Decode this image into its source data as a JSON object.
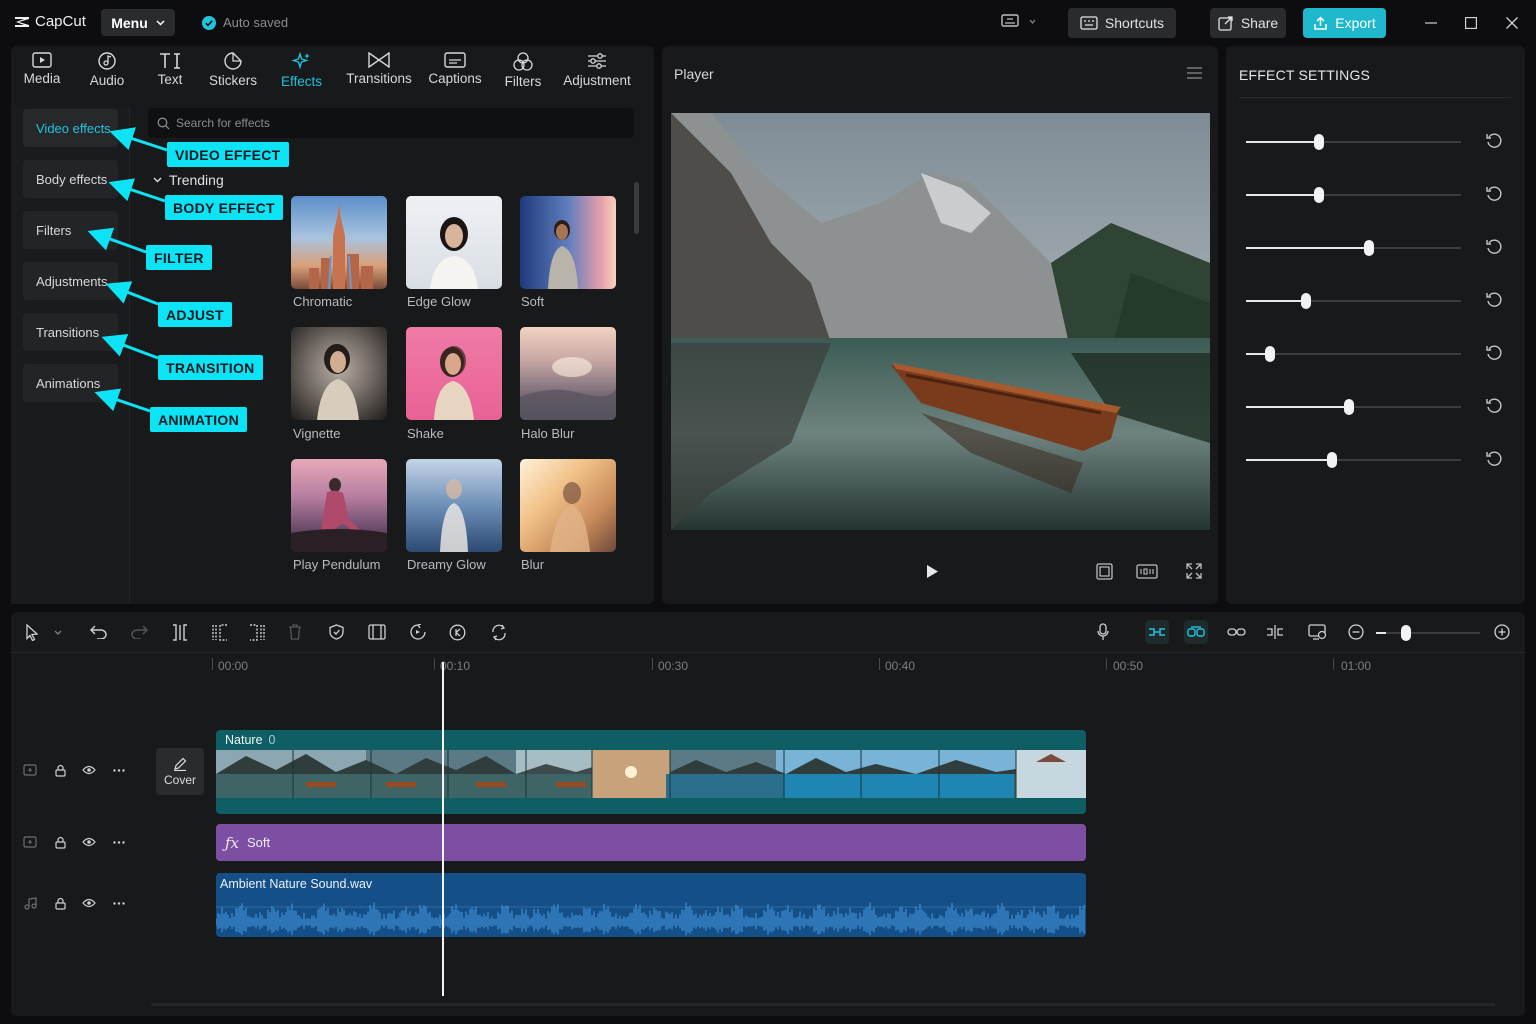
{
  "app": {
    "name": "CapCut",
    "menu_label": "Menu",
    "autosave_text": "Auto saved"
  },
  "topbar": {
    "shortcuts_label": "Shortcuts",
    "share_label": "Share",
    "export_label": "Export"
  },
  "colors": {
    "accent": "#21c3dd",
    "callout": "#0ce3f4",
    "export": "#1fb7cc",
    "effect_clip": "#7c4fa3",
    "audio_clip": "#154f88",
    "video_clip": "#0f5e63"
  },
  "tabs": [
    {
      "label": "Media",
      "icon": "media-icon"
    },
    {
      "label": "Audio",
      "icon": "audio-icon"
    },
    {
      "label": "Text",
      "icon": "text-icon"
    },
    {
      "label": "Stickers",
      "icon": "stickers-icon"
    },
    {
      "label": "Effects",
      "icon": "effects-icon",
      "active": true
    },
    {
      "label": "Transitions",
      "icon": "transitions-icon"
    },
    {
      "label": "Captions",
      "icon": "captions-icon"
    },
    {
      "label": "Filters",
      "icon": "filters-icon"
    },
    {
      "label": "Adjustment",
      "icon": "adjustment-icon"
    }
  ],
  "categories": [
    "Video effects",
    "Body effects",
    "Filters",
    "Adjustments",
    "Transitions",
    "Animations"
  ],
  "callouts": [
    "VIDEO EFFECT",
    "BODY EFFECT",
    "FILTER",
    "ADJUST",
    "TRANSITION",
    "ANIMATION"
  ],
  "search": {
    "placeholder": "Search for effects"
  },
  "trending_label": "Trending",
  "effects": [
    "Chromatic",
    "Edge Glow",
    "Soft",
    "Vignette",
    "Shake",
    "Halo Blur",
    "Play Pendulum",
    "Dreamy Glow",
    "Blur"
  ],
  "player": {
    "title": "Player"
  },
  "effect_settings": {
    "title": "EFFECT SETTINGS",
    "slider_levels": [
      0.34,
      0.34,
      0.57,
      0.28,
      0.11,
      0.48,
      0.4
    ]
  },
  "timeline": {
    "ruler": [
      "00:00",
      "00:10",
      "00:30",
      "00:40",
      "00:50",
      "01:00"
    ],
    "video_clip_label": "Nature",
    "video_clip_count": "0",
    "cover_label": "Cover",
    "effect_clip_label": "Soft",
    "audio_clip_label": "Ambient Nature Sound.wav",
    "zoom_level": 0.1
  }
}
